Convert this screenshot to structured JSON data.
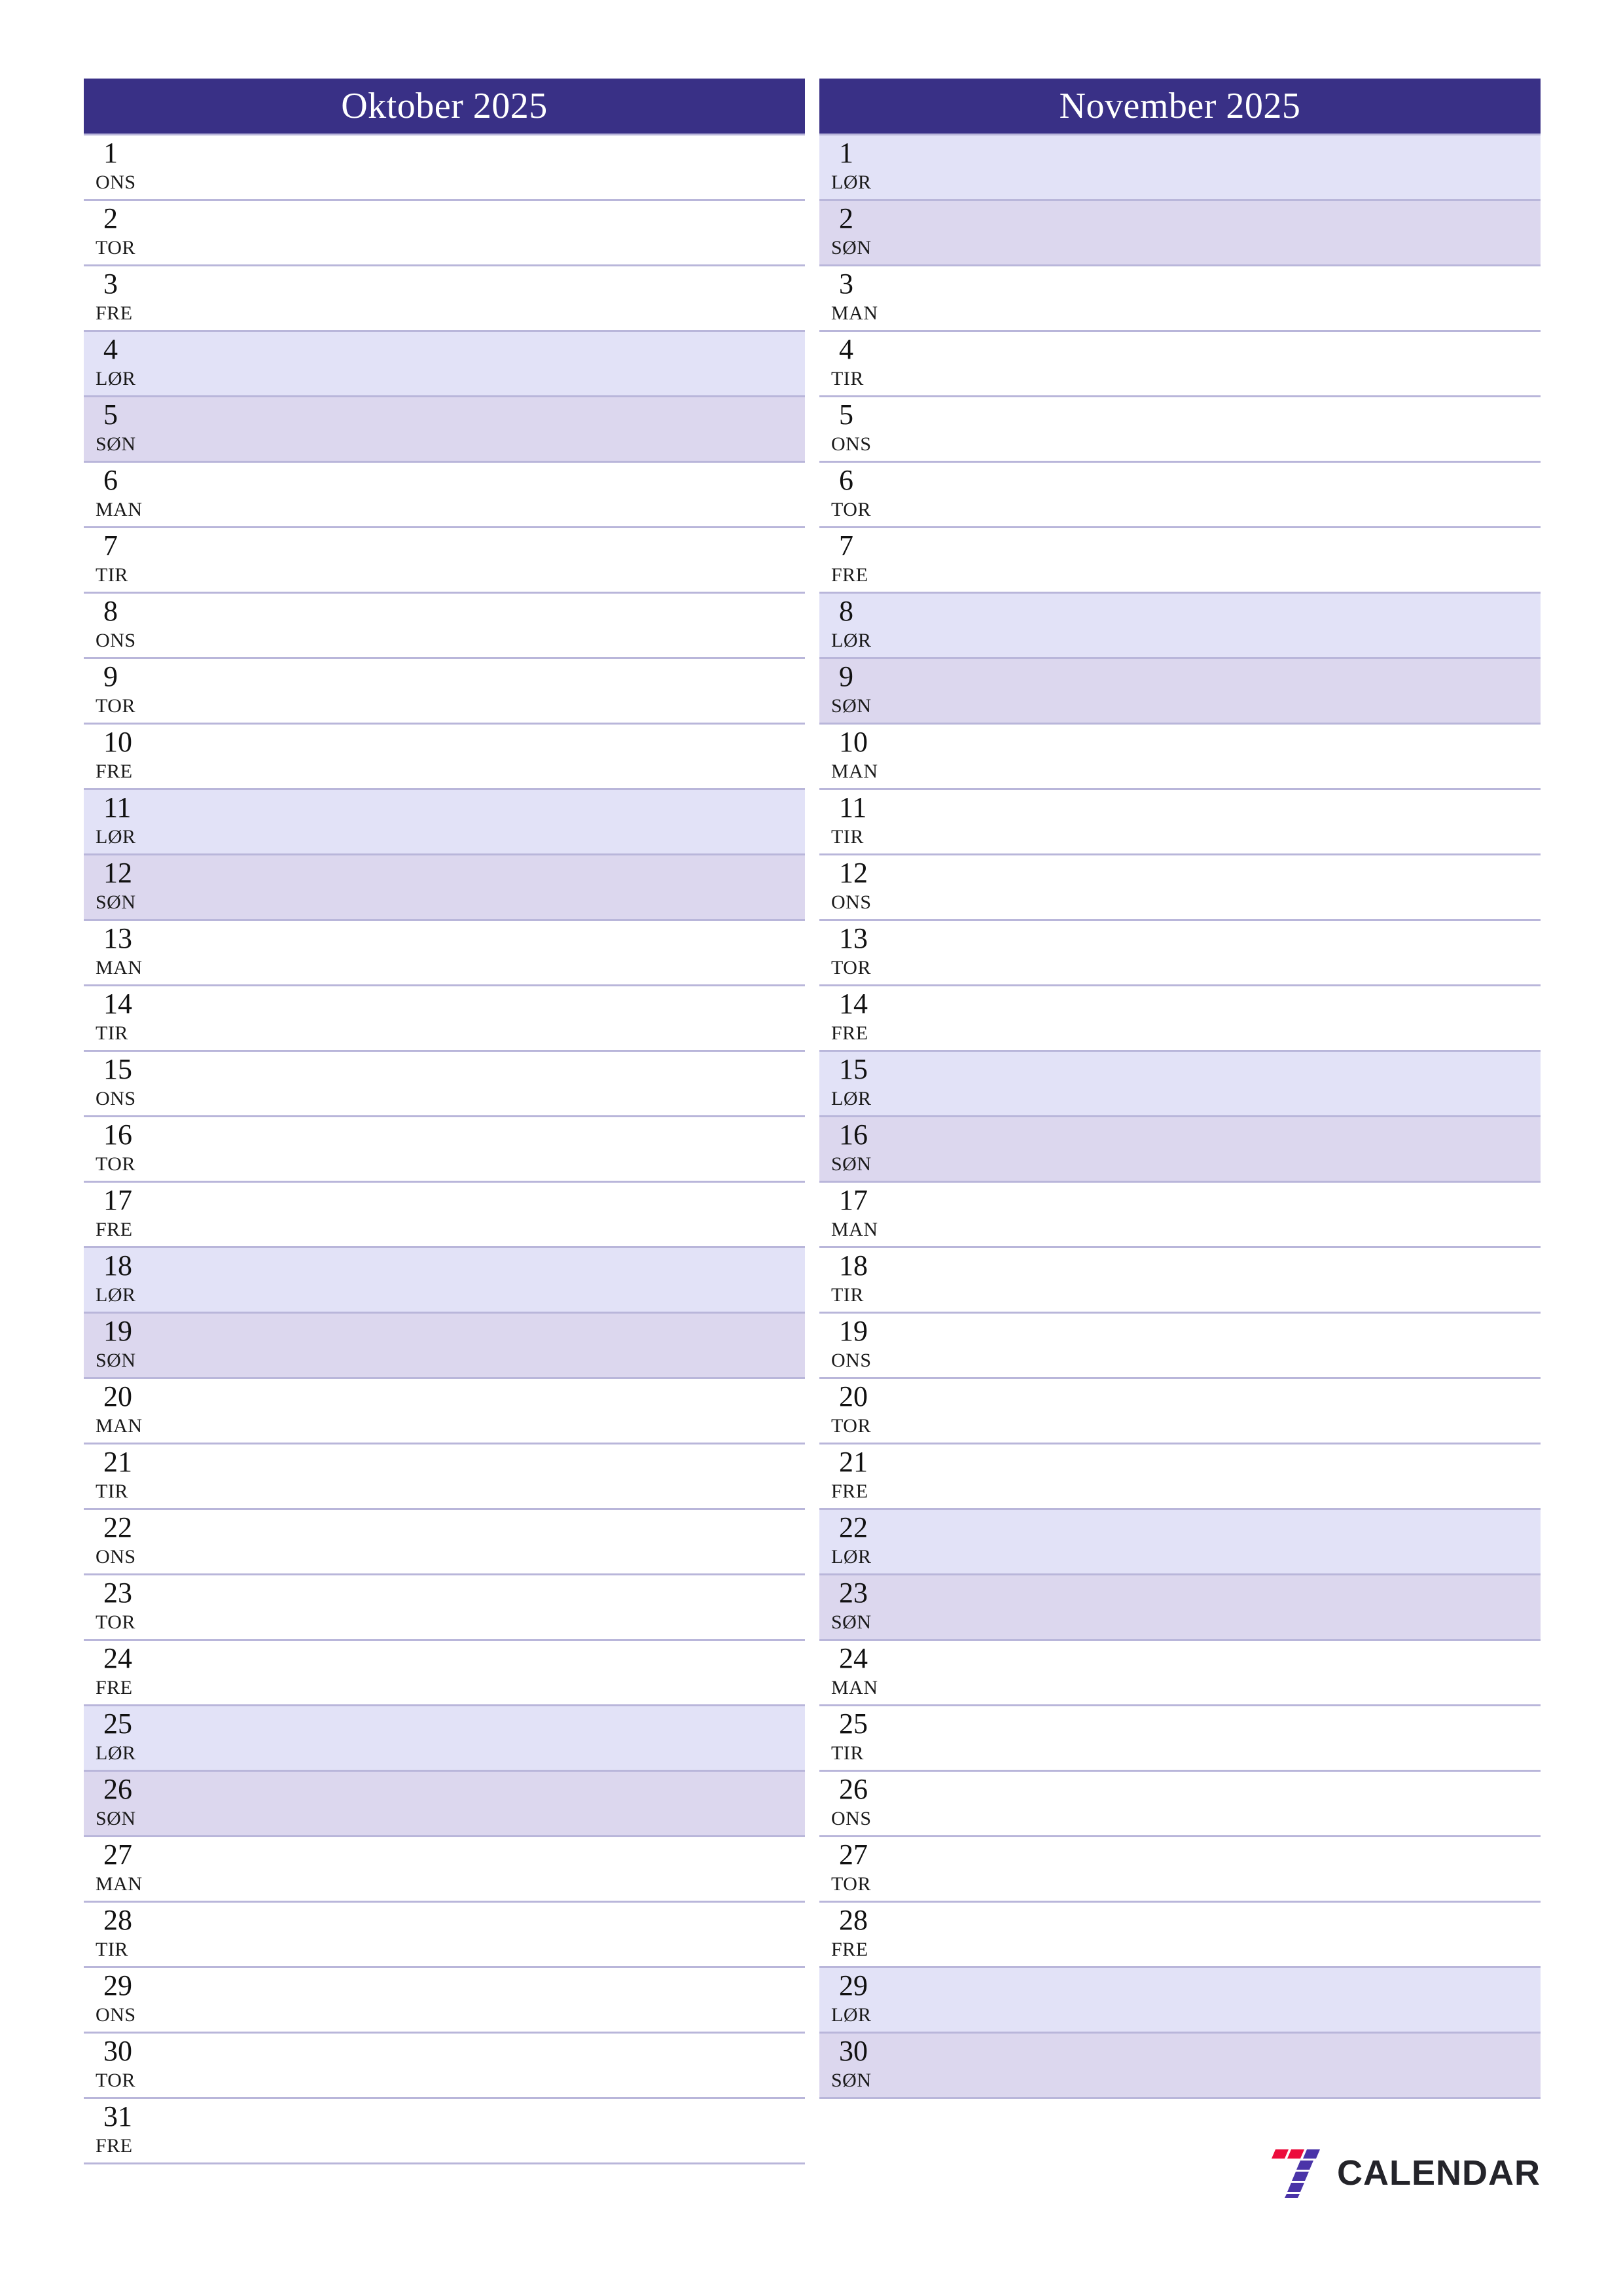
{
  "document": {
    "type": "monthly-planner",
    "orientation": "portrait",
    "language": "Norwegian"
  },
  "colors": {
    "header_background": "#393086",
    "header_text": "#ffffff",
    "saturday_background": "#e2e2f7",
    "sunday_background": "#dcd7ee",
    "row_border": "#b9b6da",
    "day_text": "#111111",
    "page_background": "#ffffff",
    "logo_red": "#ec0d3c",
    "logo_purple": "#4a34a8",
    "logo_text": "#24242a"
  },
  "months": [
    {
      "title": "Oktober 2025",
      "days": [
        {
          "num": "1",
          "weekday": "ONS",
          "type": "weekday"
        },
        {
          "num": "2",
          "weekday": "TOR",
          "type": "weekday"
        },
        {
          "num": "3",
          "weekday": "FRE",
          "type": "weekday"
        },
        {
          "num": "4",
          "weekday": "LØR",
          "type": "saturday"
        },
        {
          "num": "5",
          "weekday": "SØN",
          "type": "sunday"
        },
        {
          "num": "6",
          "weekday": "MAN",
          "type": "weekday"
        },
        {
          "num": "7",
          "weekday": "TIR",
          "type": "weekday"
        },
        {
          "num": "8",
          "weekday": "ONS",
          "type": "weekday"
        },
        {
          "num": "9",
          "weekday": "TOR",
          "type": "weekday"
        },
        {
          "num": "10",
          "weekday": "FRE",
          "type": "weekday"
        },
        {
          "num": "11",
          "weekday": "LØR",
          "type": "saturday"
        },
        {
          "num": "12",
          "weekday": "SØN",
          "type": "sunday"
        },
        {
          "num": "13",
          "weekday": "MAN",
          "type": "weekday"
        },
        {
          "num": "14",
          "weekday": "TIR",
          "type": "weekday"
        },
        {
          "num": "15",
          "weekday": "ONS",
          "type": "weekday"
        },
        {
          "num": "16",
          "weekday": "TOR",
          "type": "weekday"
        },
        {
          "num": "17",
          "weekday": "FRE",
          "type": "weekday"
        },
        {
          "num": "18",
          "weekday": "LØR",
          "type": "saturday"
        },
        {
          "num": "19",
          "weekday": "SØN",
          "type": "sunday"
        },
        {
          "num": "20",
          "weekday": "MAN",
          "type": "weekday"
        },
        {
          "num": "21",
          "weekday": "TIR",
          "type": "weekday"
        },
        {
          "num": "22",
          "weekday": "ONS",
          "type": "weekday"
        },
        {
          "num": "23",
          "weekday": "TOR",
          "type": "weekday"
        },
        {
          "num": "24",
          "weekday": "FRE",
          "type": "weekday"
        },
        {
          "num": "25",
          "weekday": "LØR",
          "type": "saturday"
        },
        {
          "num": "26",
          "weekday": "SØN",
          "type": "sunday"
        },
        {
          "num": "27",
          "weekday": "MAN",
          "type": "weekday"
        },
        {
          "num": "28",
          "weekday": "TIR",
          "type": "weekday"
        },
        {
          "num": "29",
          "weekday": "ONS",
          "type": "weekday"
        },
        {
          "num": "30",
          "weekday": "TOR",
          "type": "weekday"
        },
        {
          "num": "31",
          "weekday": "FRE",
          "type": "weekday"
        }
      ]
    },
    {
      "title": "November 2025",
      "days": [
        {
          "num": "1",
          "weekday": "LØR",
          "type": "saturday"
        },
        {
          "num": "2",
          "weekday": "SØN",
          "type": "sunday"
        },
        {
          "num": "3",
          "weekday": "MAN",
          "type": "weekday"
        },
        {
          "num": "4",
          "weekday": "TIR",
          "type": "weekday"
        },
        {
          "num": "5",
          "weekday": "ONS",
          "type": "weekday"
        },
        {
          "num": "6",
          "weekday": "TOR",
          "type": "weekday"
        },
        {
          "num": "7",
          "weekday": "FRE",
          "type": "weekday"
        },
        {
          "num": "8",
          "weekday": "LØR",
          "type": "saturday"
        },
        {
          "num": "9",
          "weekday": "SØN",
          "type": "sunday"
        },
        {
          "num": "10",
          "weekday": "MAN",
          "type": "weekday"
        },
        {
          "num": "11",
          "weekday": "TIR",
          "type": "weekday"
        },
        {
          "num": "12",
          "weekday": "ONS",
          "type": "weekday"
        },
        {
          "num": "13",
          "weekday": "TOR",
          "type": "weekday"
        },
        {
          "num": "14",
          "weekday": "FRE",
          "type": "weekday"
        },
        {
          "num": "15",
          "weekday": "LØR",
          "type": "saturday"
        },
        {
          "num": "16",
          "weekday": "SØN",
          "type": "sunday"
        },
        {
          "num": "17",
          "weekday": "MAN",
          "type": "weekday"
        },
        {
          "num": "18",
          "weekday": "TIR",
          "type": "weekday"
        },
        {
          "num": "19",
          "weekday": "ONS",
          "type": "weekday"
        },
        {
          "num": "20",
          "weekday": "TOR",
          "type": "weekday"
        },
        {
          "num": "21",
          "weekday": "FRE",
          "type": "weekday"
        },
        {
          "num": "22",
          "weekday": "LØR",
          "type": "saturday"
        },
        {
          "num": "23",
          "weekday": "SØN",
          "type": "sunday"
        },
        {
          "num": "24",
          "weekday": "MAN",
          "type": "weekday"
        },
        {
          "num": "25",
          "weekday": "TIR",
          "type": "weekday"
        },
        {
          "num": "26",
          "weekday": "ONS",
          "type": "weekday"
        },
        {
          "num": "27",
          "weekday": "TOR",
          "type": "weekday"
        },
        {
          "num": "28",
          "weekday": "FRE",
          "type": "weekday"
        },
        {
          "num": "29",
          "weekday": "LØR",
          "type": "saturday"
        },
        {
          "num": "30",
          "weekday": "SØN",
          "type": "sunday"
        }
      ]
    }
  ],
  "footer": {
    "logo_icon": "seven-stripes-icon",
    "brand": "CALENDAR"
  }
}
